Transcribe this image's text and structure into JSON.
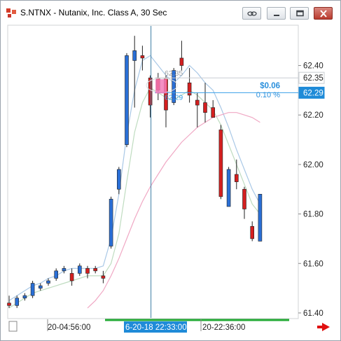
{
  "window": {
    "title": "S.NTNX - Nutanix, Inc. Class A, 30 Sec",
    "buttons": [
      "link-icon",
      "minimize-icon",
      "restore-icon",
      "close-icon"
    ]
  },
  "chart_data": {
    "type": "candlestick",
    "symbol": "S.NTNX",
    "interval": "30 Sec",
    "ylim": [
      61.38,
      62.56
    ],
    "y_ticks": [
      "62.40",
      "62.20",
      "62.00",
      "61.80",
      "61.60",
      "61.40"
    ],
    "price_labels": [
      {
        "text": "62.35",
        "value": 62.35,
        "style": "plain"
      },
      {
        "text": "62.29",
        "value": 62.29,
        "style": "highlight"
      }
    ],
    "x_labels": [
      "20-04:56:00",
      "6-20-18 22:33:00",
      "20-22:36:00"
    ],
    "measure": {
      "change": "$0.06",
      "percent": "0.10 %",
      "from_label": "62.29",
      "to_label": "62.35"
    },
    "candles": [
      {
        "o": 61.44,
        "h": 61.47,
        "l": 61.42,
        "c": 61.43
      },
      {
        "o": 61.43,
        "h": 61.47,
        "l": 61.42,
        "c": 61.46
      },
      {
        "o": 61.46,
        "h": 61.48,
        "l": 61.45,
        "c": 61.47
      },
      {
        "o": 61.47,
        "h": 61.53,
        "l": 61.46,
        "c": 61.52
      },
      {
        "o": 61.5,
        "h": 61.52,
        "l": 61.49,
        "c": 61.51
      },
      {
        "o": 61.52,
        "h": 61.54,
        "l": 61.51,
        "c": 61.53
      },
      {
        "o": 61.54,
        "h": 61.58,
        "l": 61.53,
        "c": 61.57
      },
      {
        "o": 61.57,
        "h": 61.59,
        "l": 61.56,
        "c": 61.58
      },
      {
        "o": 61.56,
        "h": 61.58,
        "l": 61.51,
        "c": 61.53
      },
      {
        "o": 61.56,
        "h": 61.6,
        "l": 61.55,
        "c": 61.59
      },
      {
        "o": 61.58,
        "h": 61.59,
        "l": 61.54,
        "c": 61.56
      },
      {
        "o": 61.58,
        "h": 61.59,
        "l": 61.56,
        "c": 61.57
      },
      {
        "o": 61.55,
        "h": 61.57,
        "l": 61.52,
        "c": 61.54
      },
      {
        "o": 61.67,
        "h": 61.87,
        "l": 61.66,
        "c": 61.86
      },
      {
        "o": 61.9,
        "h": 61.99,
        "l": 61.88,
        "c": 61.98
      },
      {
        "o": 62.08,
        "h": 62.45,
        "l": 62.07,
        "c": 62.44
      },
      {
        "o": 62.42,
        "h": 62.52,
        "l": 62.23,
        "c": 62.46
      },
      {
        "o": 62.44,
        "h": 62.48,
        "l": 62.38,
        "c": 62.43
      },
      {
        "o": 62.35,
        "h": 62.36,
        "l": 62.19,
        "c": 62.24
      },
      {
        "o": 62.35,
        "h": 62.37,
        "l": 62.26,
        "c": 62.3
      },
      {
        "o": 62.35,
        "h": 62.36,
        "l": 62.15,
        "c": 62.22
      },
      {
        "o": 62.25,
        "h": 62.39,
        "l": 62.24,
        "c": 62.38
      },
      {
        "o": 62.43,
        "h": 62.5,
        "l": 62.38,
        "c": 62.4
      },
      {
        "o": 62.33,
        "h": 62.39,
        "l": 62.25,
        "c": 62.28
      },
      {
        "o": 62.26,
        "h": 62.29,
        "l": 62.15,
        "c": 62.24
      },
      {
        "o": 62.25,
        "h": 62.33,
        "l": 62.17,
        "c": 62.21
      },
      {
        "o": 62.23,
        "h": 62.26,
        "l": 62.19,
        "c": 62.19
      },
      {
        "o": 62.14,
        "h": 62.16,
        "l": 61.86,
        "c": 61.87
      },
      {
        "o": 61.83,
        "h": 61.99,
        "l": 61.83,
        "c": 61.98
      },
      {
        "o": 61.96,
        "h": 62.02,
        "l": 61.9,
        "c": 61.93
      },
      {
        "o": 61.9,
        "h": 61.91,
        "l": 61.78,
        "c": 61.82
      },
      {
        "o": 61.75,
        "h": 61.77,
        "l": 61.69,
        "c": 61.7
      },
      {
        "o": 61.69,
        "h": 61.88,
        "l": 61.69,
        "c": 61.88
      }
    ],
    "series": [
      {
        "type": "line",
        "color": "#a9c8e6",
        "values": [
          61.45,
          61.47,
          61.49,
          61.51,
          61.52,
          61.54,
          61.55,
          61.57,
          61.58,
          61.58,
          61.58,
          61.58,
          61.59,
          61.7,
          61.88,
          62.12,
          62.3,
          62.42,
          62.44,
          62.4,
          62.36,
          62.33,
          62.36,
          62.4,
          62.37,
          62.33,
          62.3,
          62.23,
          62.15,
          62.06,
          61.98,
          61.9,
          61.84
        ]
      },
      {
        "type": "line",
        "color": "#bfdcc0",
        "values": [
          61.42,
          61.44,
          61.46,
          61.48,
          61.49,
          61.5,
          61.51,
          61.52,
          61.53,
          61.54,
          61.55,
          61.55,
          61.55,
          61.6,
          61.72,
          61.93,
          62.13,
          62.25,
          62.31,
          62.29,
          62.27,
          62.26,
          62.28,
          62.3,
          62.28,
          62.25,
          62.22,
          62.16,
          62.08,
          62.0,
          61.92,
          61.84,
          61.8
        ]
      },
      {
        "type": "line",
        "color": "#f0a8c4",
        "values": [
          null,
          null,
          null,
          null,
          null,
          null,
          null,
          null,
          null,
          null,
          61.42,
          61.45,
          61.49,
          61.55,
          61.62,
          61.7,
          61.78,
          61.85,
          61.91,
          61.96,
          62.01,
          62.05,
          62.09,
          62.12,
          62.15,
          62.17,
          62.19,
          62.2,
          62.21,
          62.21,
          62.2,
          62.19,
          62.17
        ]
      }
    ]
  }
}
